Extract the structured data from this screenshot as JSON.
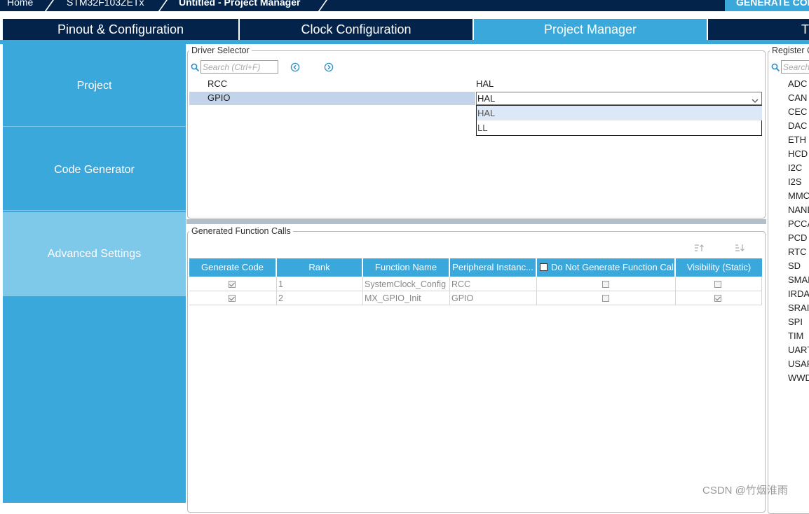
{
  "breadcrumb": {
    "home": "Home",
    "mcu": "STM32F103ZETx",
    "current": "Untitled - Project Manager"
  },
  "generate_button": "GENERATE CODE",
  "tabs": [
    {
      "label": "Pinout & Configuration"
    },
    {
      "label": "Clock Configuration"
    },
    {
      "label": "Project Manager"
    },
    {
      "label": "T"
    }
  ],
  "sidebar": {
    "items": [
      {
        "label": "Project"
      },
      {
        "label": "Code Generator"
      },
      {
        "label": "Advanced Settings"
      }
    ]
  },
  "driver_selector": {
    "title": "Driver Selector",
    "search_placeholder": "Search (Ctrl+F)",
    "rows": [
      {
        "peripheral": "RCC",
        "driver": "HAL"
      },
      {
        "peripheral": "GPIO",
        "driver": "HAL"
      }
    ],
    "dropdown_options": [
      "HAL",
      "LL"
    ]
  },
  "function_calls": {
    "title": "Generated Function Calls",
    "columns": [
      "Generate Code",
      "Rank",
      "Function Name",
      "Peripheral Instanc...",
      "Do Not Generate Function Call",
      "Visibility (Static)"
    ],
    "rows": [
      {
        "generate": true,
        "rank": "1",
        "function": "SystemClock_Config",
        "peripheral": "RCC",
        "do_not_generate": false,
        "visibility": false
      },
      {
        "generate": true,
        "rank": "2",
        "function": "MX_GPIO_Init",
        "peripheral": "GPIO",
        "do_not_generate": false,
        "visibility": true
      }
    ]
  },
  "register_callback": {
    "title": "Register C",
    "search_placeholder": "Search",
    "items": [
      "ADC",
      "CAN",
      "CEC",
      "DAC",
      "ETH",
      "HCD",
      "I2C",
      "I2S",
      "MMC",
      "NAND",
      "PCCA",
      "PCD",
      "RTC",
      "SD",
      "SMAI",
      "IRDA",
      "SRAI",
      "SPI",
      "TIM",
      "UART",
      "USAR",
      "WWD"
    ]
  },
  "watermark": "CSDN @竹烟淮雨",
  "colors": {
    "navy": "#03234b",
    "accent": "#3ba8dc",
    "sidebar_selected": "#7ec8ea",
    "row_selected": "#c3d4ea"
  }
}
